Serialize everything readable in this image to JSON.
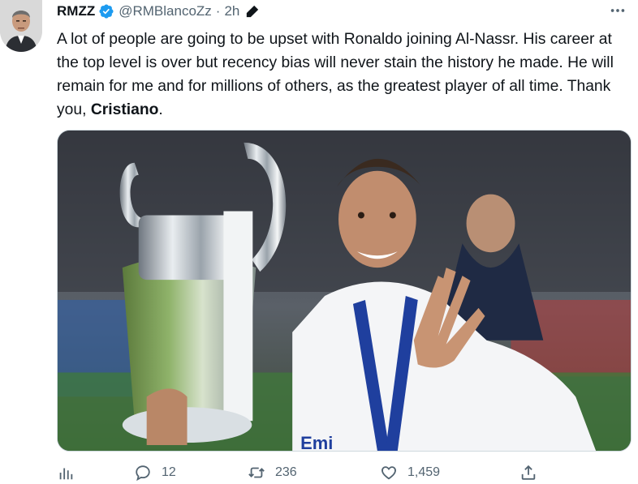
{
  "tweet": {
    "author_name": "RMZZ",
    "handle": "@RMBlancoZz",
    "separator": "·",
    "time": "2h",
    "text_before": "A lot of people are going to be upset with Ronaldo joining Al-Nassr. His career at the top level is over but recency bias will never stain the history he made. He will remain for me and for millions of others, as the greatest player of all time. Thank you, ",
    "text_bold": "Cristiano",
    "text_after": ".",
    "icons": {
      "verified": "verified-badge-icon",
      "edited": "edit-pencil-icon",
      "more": "more-dots-icon"
    },
    "media_description_shown": false
  },
  "actions": {
    "analytics_icon": "analytics-icon",
    "reply_count": "12",
    "retweet_count": "236",
    "like_count": "1,459",
    "share_icon": "share-icon"
  },
  "colors": {
    "text": "#0f1419",
    "secondary": "#536471",
    "verified": "#1d9bf0",
    "border": "#cfd9de"
  }
}
